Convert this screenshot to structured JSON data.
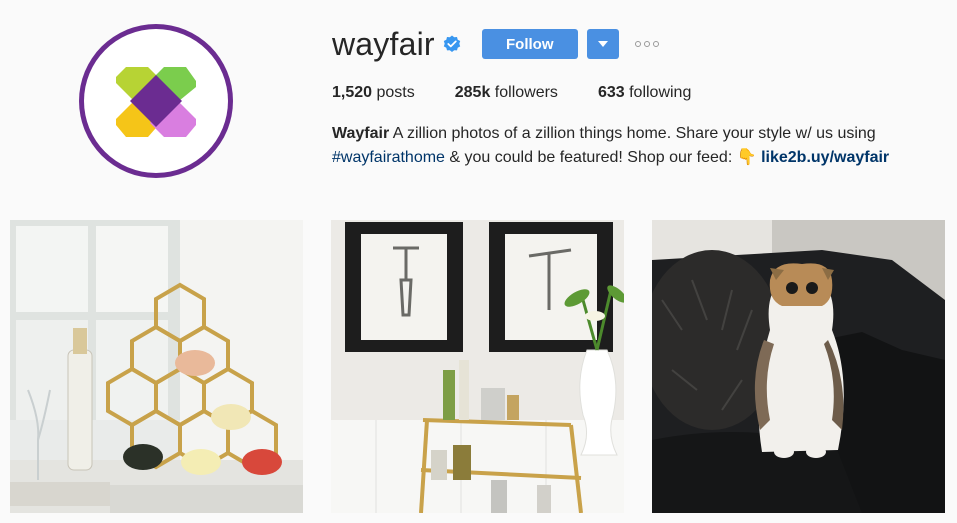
{
  "profile": {
    "username": "wayfair",
    "verified": true,
    "follow_label": "Follow",
    "dropdown_icon": "caret-down-icon",
    "more_icon": "ellipsis-icon",
    "stats": {
      "posts_count": "1,520",
      "posts_label": "posts",
      "followers_count": "285k",
      "followers_label": "followers",
      "following_count": "633",
      "following_label": "following"
    },
    "bio": {
      "name": "Wayfair",
      "text1": " A zillion photos of a zillion things home. Share your style w/ us using ",
      "hashtag": "#wayfairathome",
      "text2": " & you could be featured! Shop our feed: ",
      "emoji": "👇",
      "link": "like2b.uy/wayfair"
    }
  },
  "colors": {
    "accent": "#4a90e2",
    "logo_ring": "#6b2c91",
    "link": "#003569"
  },
  "posts": [
    {
      "subject": "gold hexagon wine rack with bottles"
    },
    {
      "subject": "bar cart with corkscrew prints"
    },
    {
      "subject": "scottish fold cat on leather chair"
    }
  ]
}
